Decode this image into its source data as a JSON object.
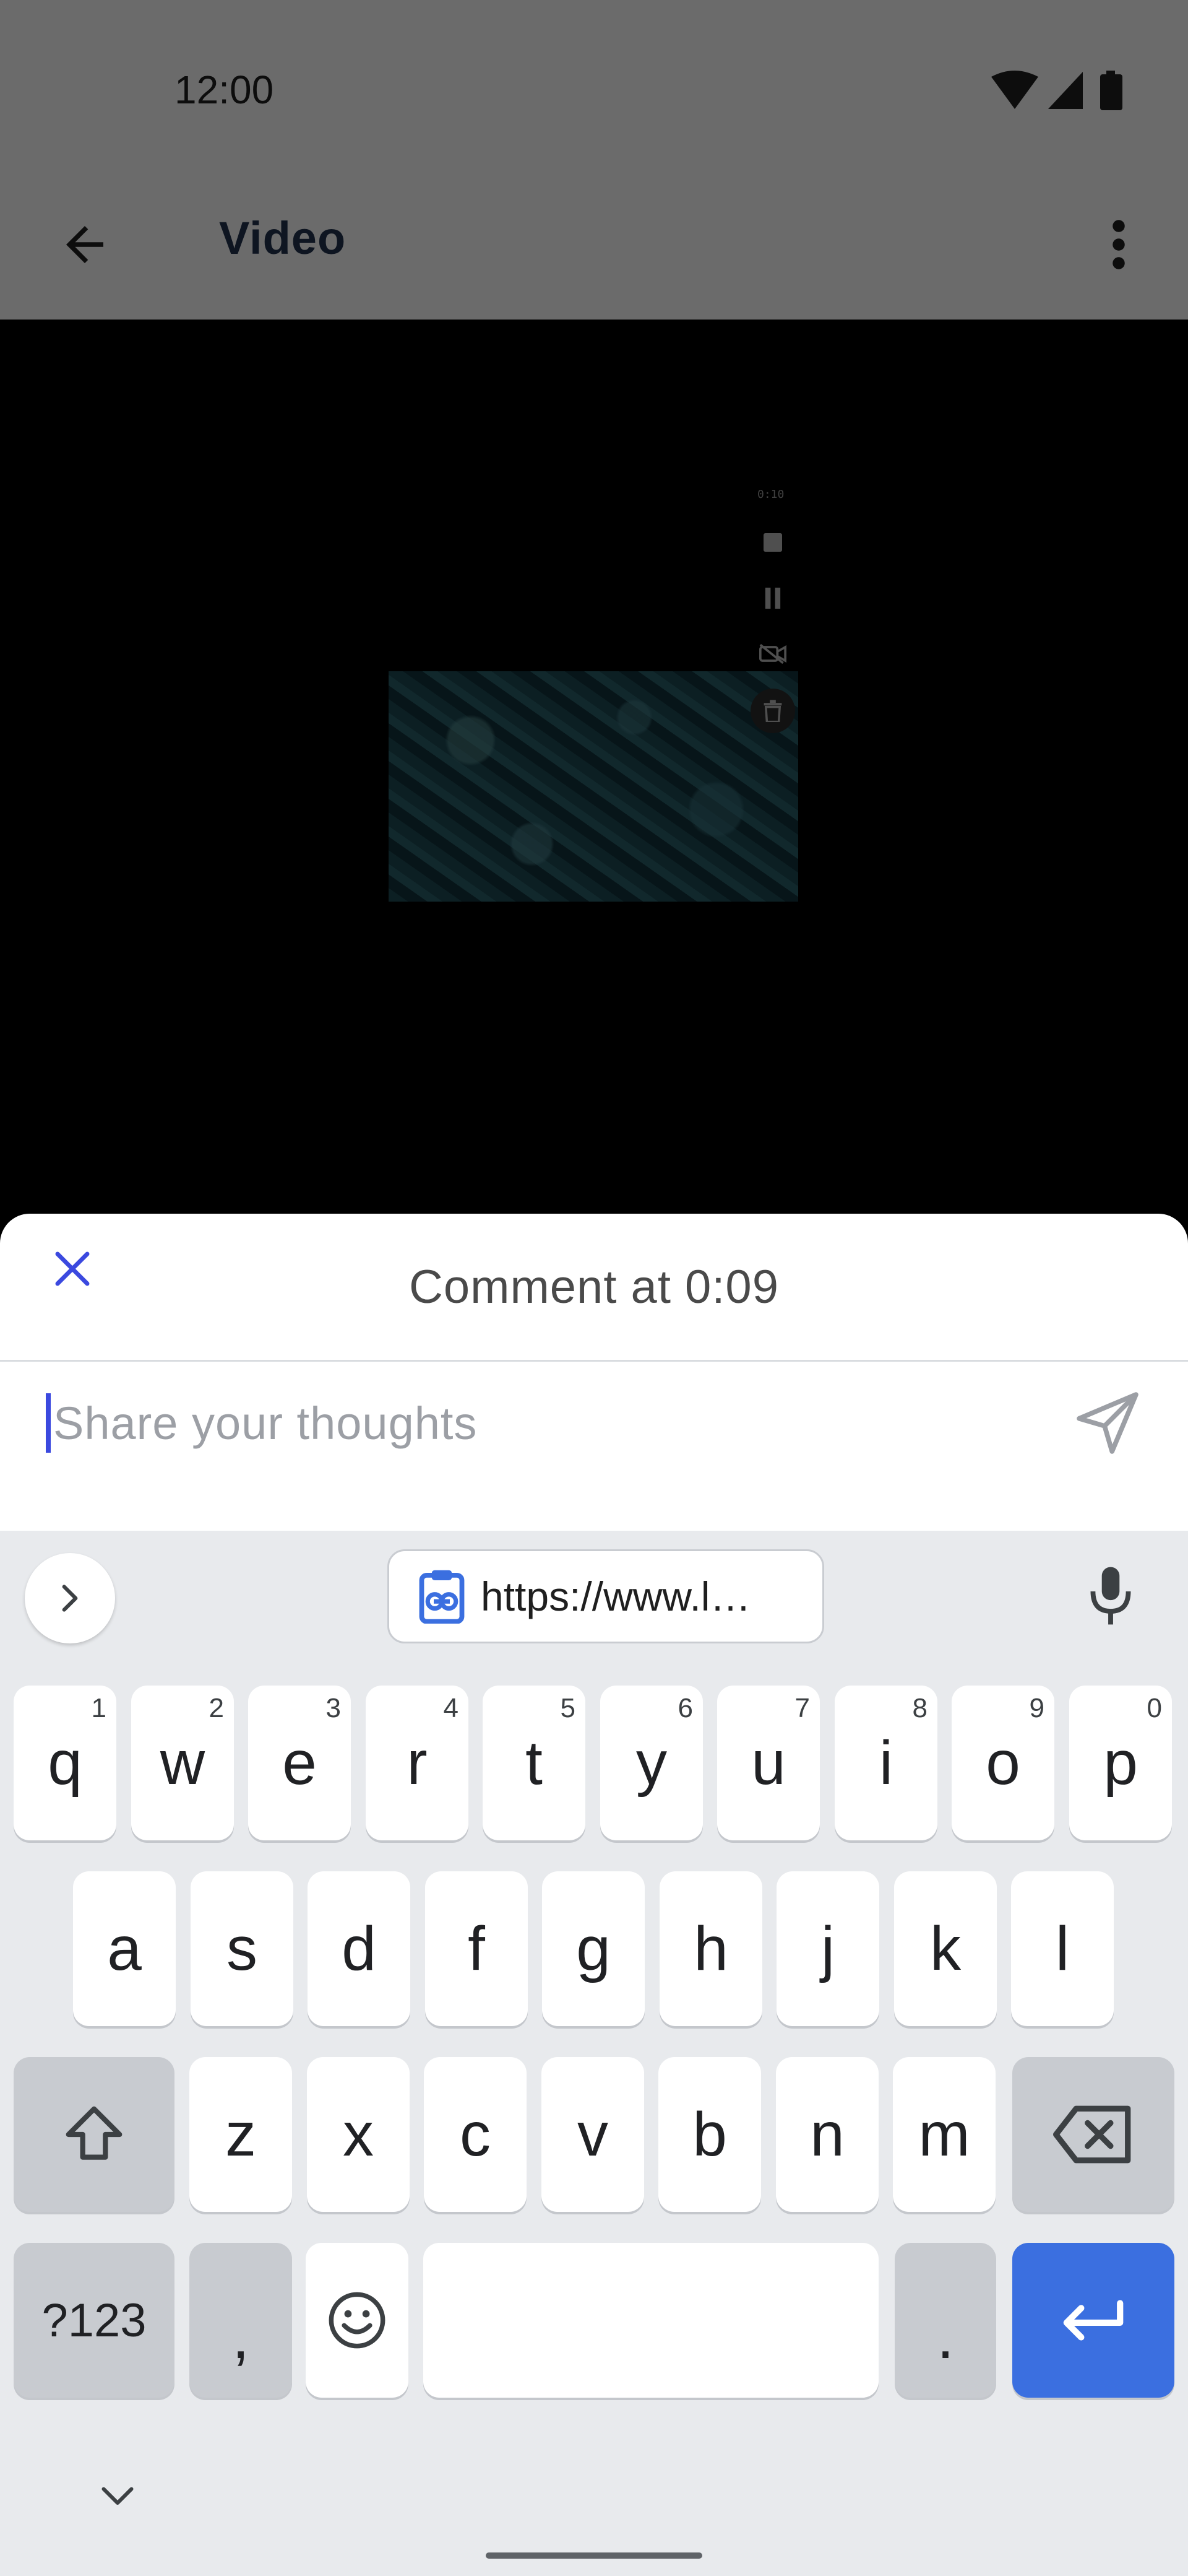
{
  "status_bar": {
    "time": "12:00"
  },
  "app_bar": {
    "title": "Video"
  },
  "recorder": {
    "elapsed": "0:10"
  },
  "comment_sheet": {
    "title": "Comment at 0:09",
    "input_placeholder": "Share your thoughts"
  },
  "keyboard": {
    "clipboard_suggestion": "https://www.l…",
    "row1": [
      {
        "label": "q",
        "hint": "1"
      },
      {
        "label": "w",
        "hint": "2"
      },
      {
        "label": "e",
        "hint": "3"
      },
      {
        "label": "r",
        "hint": "4"
      },
      {
        "label": "t",
        "hint": "5"
      },
      {
        "label": "y",
        "hint": "6"
      },
      {
        "label": "u",
        "hint": "7"
      },
      {
        "label": "i",
        "hint": "8"
      },
      {
        "label": "o",
        "hint": "9"
      },
      {
        "label": "p",
        "hint": "0"
      }
    ],
    "row2": [
      "a",
      "s",
      "d",
      "f",
      "g",
      "h",
      "j",
      "k",
      "l"
    ],
    "row3": [
      "z",
      "x",
      "c",
      "v",
      "b",
      "n",
      "m"
    ],
    "symbols_label": "?123",
    "comma_label": ",",
    "period_label": "."
  },
  "colors": {
    "accent": "#3b49df",
    "enter_key": "#3b6fe0",
    "keyboard_bg": "#e8eaed",
    "modifier_key": "#c8cbd0"
  },
  "icons": {
    "back": "arrow-left-icon",
    "menu": "more-vert-icon",
    "close": "close-icon",
    "send": "send-icon",
    "expand": "chevron-right-icon",
    "clipboard": "clipboard-link-icon",
    "mic": "microphone-icon",
    "shift": "shift-icon",
    "backspace": "backspace-icon",
    "emoji": "emoji-icon",
    "enter": "enter-icon",
    "hide_keyboard": "chevron-down-icon"
  }
}
